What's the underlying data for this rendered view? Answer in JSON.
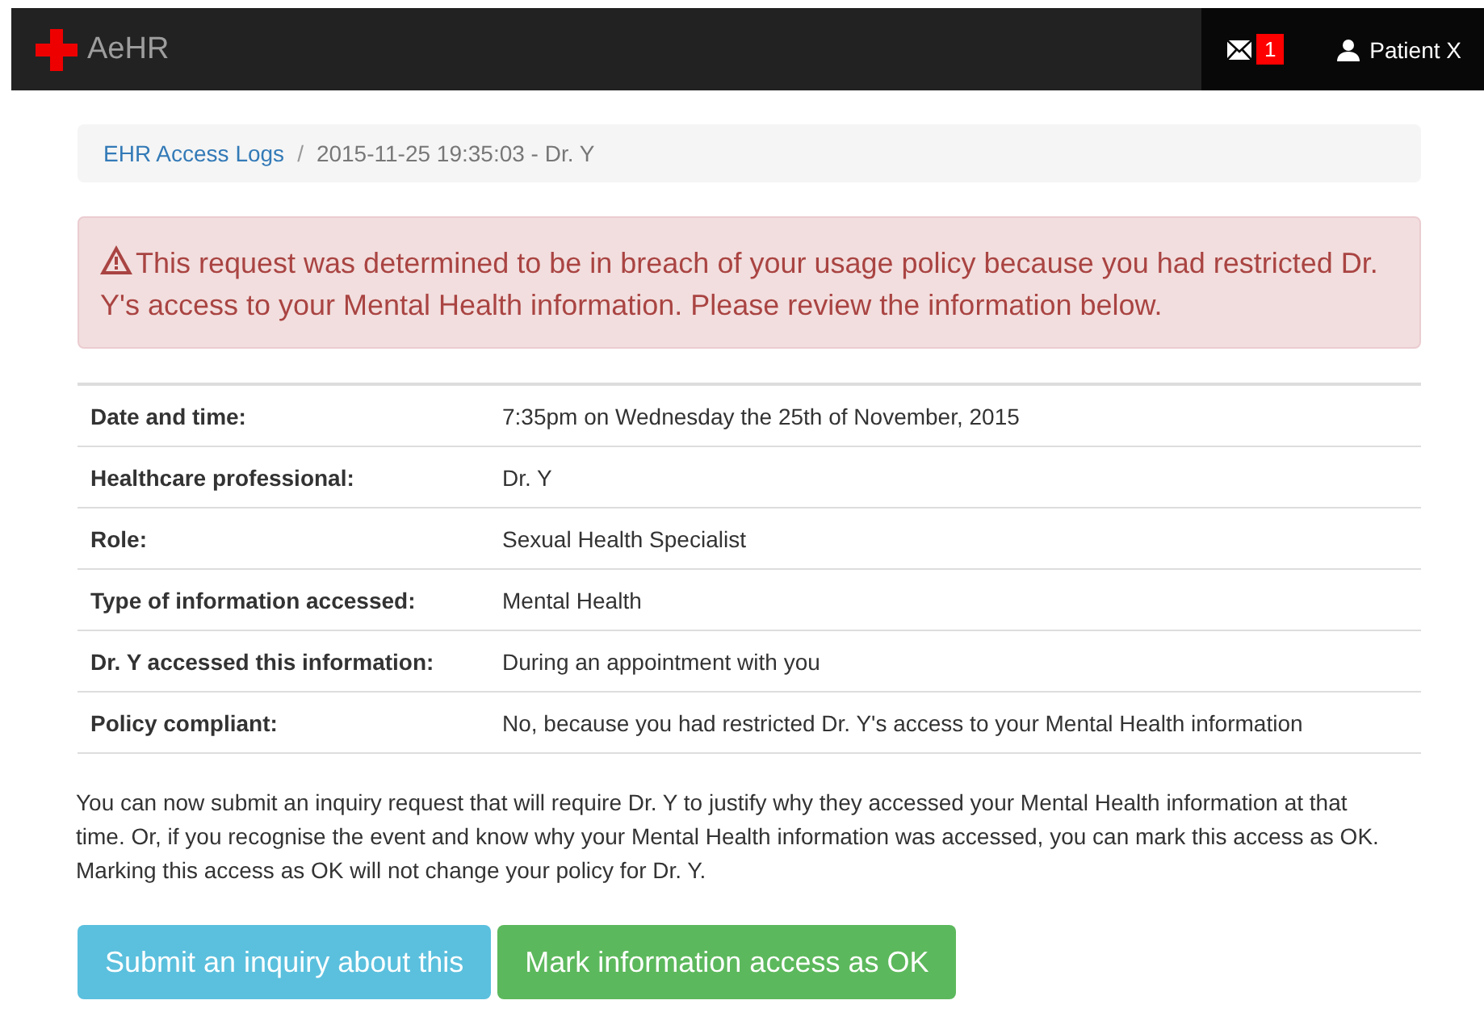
{
  "navbar": {
    "brand": "AeHR",
    "messages_count": "1",
    "user": "Patient X"
  },
  "breadcrumb": [
    {
      "label": "EHR Access Logs",
      "kind": "link"
    },
    {
      "label": "/",
      "kind": "separator"
    },
    {
      "label": "2015-11-25 19:35:03 - Dr. Y",
      "kind": "current"
    }
  ],
  "alert": {
    "text": "This request was determined to be in breach of your usage policy because you had restricted Dr. Y's access to your Mental Health information. Please review the information below."
  },
  "details": [
    {
      "label": "Date and time:",
      "value": "7:35pm on Wednesday the 25th of November, 2015"
    },
    {
      "label": "Healthcare professional:",
      "value": "Dr. Y"
    },
    {
      "label": "Role:",
      "value": "Sexual Health Specialist"
    },
    {
      "label": "Type of information accessed:",
      "value": "Mental Health"
    },
    {
      "label": "Dr. Y accessed this information:",
      "value": "During an appointment with you"
    },
    {
      "label": "Policy compliant:",
      "value": "No, because you had restricted Dr. Y's access to your Mental Health information"
    }
  ],
  "explanation": "You can now submit an inquiry request that will require Dr. Y to justify why they accessed your Mental Health information at that time. Or, if you recognise the event and know why your Mental Health information was accessed, you can mark this access as OK. Marking this access as OK will not change your policy for Dr. Y.",
  "buttons": [
    {
      "label": "Submit an inquiry about this",
      "kind": "info"
    },
    {
      "label": "Mark information access as OK",
      "kind": "success"
    }
  ]
}
